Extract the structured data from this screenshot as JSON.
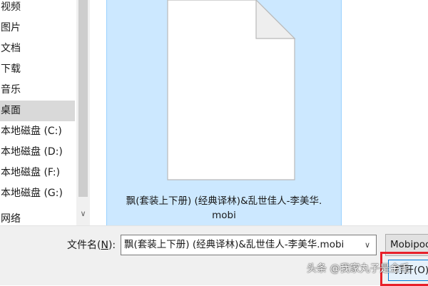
{
  "nav": {
    "items": [
      {
        "label": "视频"
      },
      {
        "label": "图片"
      },
      {
        "label": "文档"
      },
      {
        "label": "下载"
      },
      {
        "label": "音乐"
      },
      {
        "label": "桌面",
        "selected": true
      },
      {
        "label": "本地磁盘 (C:)"
      },
      {
        "label": "本地磁盘 (D:)"
      },
      {
        "label": "本地磁盘 (F:)"
      },
      {
        "label": "本地磁盘 (G:)"
      },
      {
        "label": "网络"
      }
    ],
    "scroll_down_glyph": "∨"
  },
  "file": {
    "name_line1": "飘(套装上下册) (经典译林)&乱世佳人-李美华.",
    "name_line2": "mobi",
    "icon": "document-icon"
  },
  "bottom": {
    "filename_label_text": "文件名(",
    "filename_label_hotkey": "N",
    "filename_label_suffix": "):",
    "filename_value": "飘(套装上下册) (经典译林)&乱世佳人-李美华.mobi",
    "dropdown_glyph": "∨",
    "filetype_value": "Mobipocket",
    "open_button_label": "打开(O)"
  },
  "watermark": "头条 @我家丸子是金毛",
  "colors": {
    "selection": "#cce8ff",
    "selection_border": "#99d1ff",
    "nav_selected": "#d9d9d9",
    "highlight_box": "#e8202a",
    "button_border": "#0078d7"
  }
}
